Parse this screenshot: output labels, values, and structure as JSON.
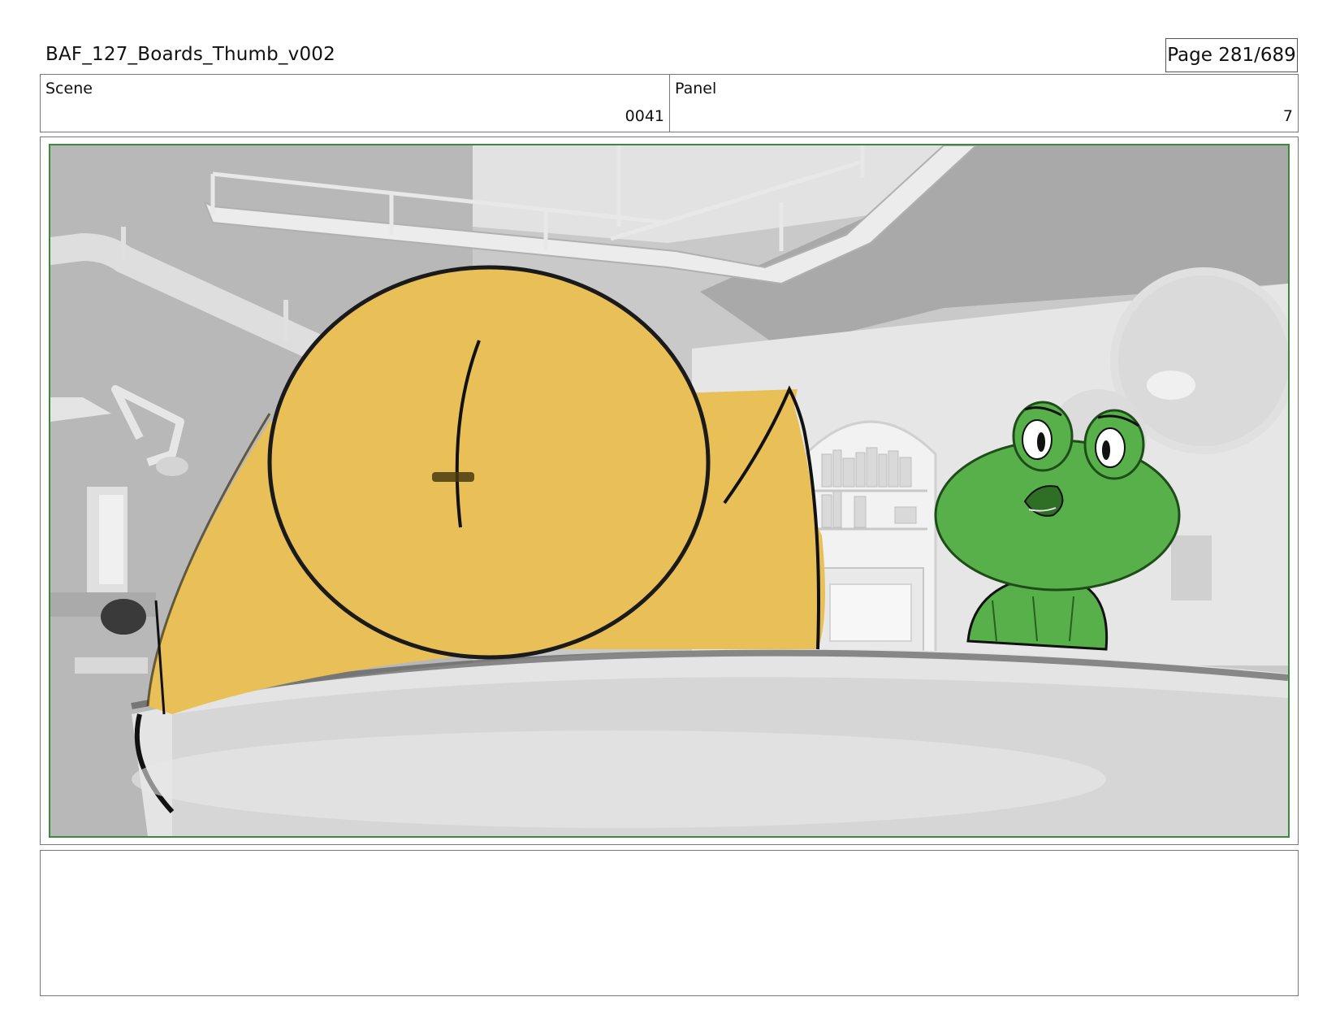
{
  "header": {
    "title": "BAF_127_Boards_Thumb_v002",
    "page": "Page 281/689"
  },
  "info": {
    "scene_label": "Scene",
    "scene_value": "0041",
    "panel_label": "Panel",
    "panel_value": "7"
  },
  "colors": {
    "frame_border": "#3a8a3a",
    "character_yellow": "#e8c057",
    "character_green": "#58b04a"
  },
  "notes": {
    "text": ""
  }
}
